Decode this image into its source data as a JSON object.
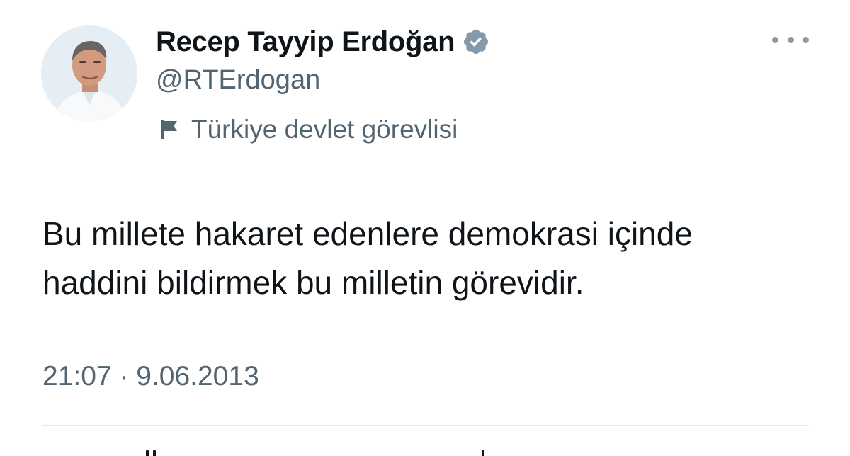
{
  "tweet": {
    "author": {
      "display_name": "Recep Tayyip Erdoğan",
      "handle": "@RTErdogan",
      "affiliation": "Türkiye devlet görevlisi",
      "avatar_icon": "profile-photo",
      "verified_icon": "verified-badge-icon",
      "verified_color": "#829aab"
    },
    "text": "Bu millete hakaret edenlere demokrasi içinde\nhaddini bildirmek bu milletin görevidir.",
    "timestamp": "21:07 · 9.06.2013"
  },
  "colors": {
    "primary_text": "#0f1419",
    "secondary_text": "#536471",
    "divider": "#e4e8eb",
    "background": "#ffffff"
  }
}
